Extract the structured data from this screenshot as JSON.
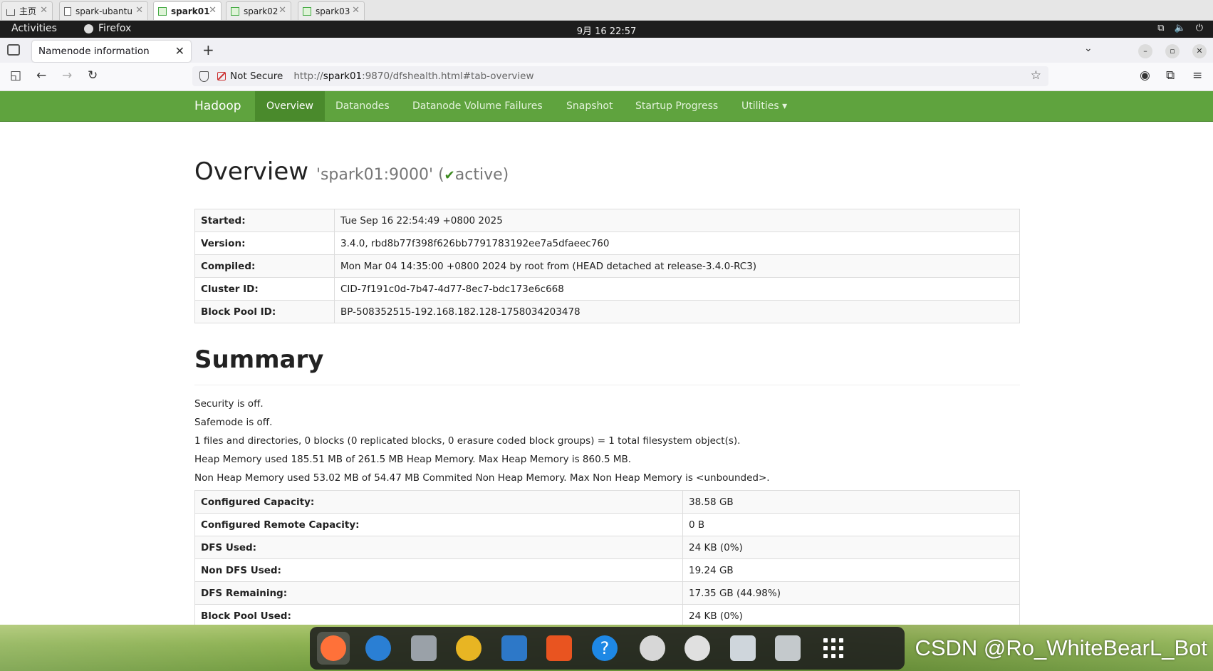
{
  "vm_tabs": [
    {
      "label": "主页",
      "active": false
    },
    {
      "label": "spark-ubantu",
      "active": false
    },
    {
      "label": "spark01",
      "active": true
    },
    {
      "label": "spark02",
      "active": false
    },
    {
      "label": "spark03",
      "active": false
    }
  ],
  "gnome": {
    "activities": "Activities",
    "app": "Firefox",
    "clock": "9月 16  22:57"
  },
  "firefox": {
    "tab_title": "Namenode information",
    "not_secure": "Not Secure",
    "url_prefix": "http://",
    "url_host": "spark01",
    "url_rest": ":9870/dfshealth.html#tab-overview"
  },
  "hadoop_nav": {
    "brand": "Hadoop",
    "items": [
      "Overview",
      "Datanodes",
      "Datanode Volume Failures",
      "Snapshot",
      "Startup Progress",
      "Utilities ▾"
    ]
  },
  "overview": {
    "title": "Overview",
    "node": "'spark01:9000' (",
    "check": "✔",
    "state": "active)",
    "rows": [
      {
        "k": "Started:",
        "v": "Tue Sep 16 22:54:49 +0800 2025"
      },
      {
        "k": "Version:",
        "v": "3.4.0, rbd8b77f398f626bb7791783192ee7a5dfaeec760"
      },
      {
        "k": "Compiled:",
        "v": "Mon Mar 04 14:35:00 +0800 2024 by root from (HEAD detached at release-3.4.0-RC3)"
      },
      {
        "k": "Cluster ID:",
        "v": "CID-7f191c0d-7b47-4d77-8ec7-bdc173e6c668"
      },
      {
        "k": "Block Pool ID:",
        "v": "BP-508352515-192.168.182.128-1758034203478"
      }
    ]
  },
  "summary": {
    "title": "Summary",
    "lines": [
      "Security is off.",
      "Safemode is off.",
      "1 files and directories, 0 blocks (0 replicated blocks, 0 erasure coded block groups) = 1 total filesystem object(s).",
      "Heap Memory used 185.51 MB of 261.5 MB Heap Memory. Max Heap Memory is 860.5 MB.",
      "Non Heap Memory used 53.02 MB of 54.47 MB Commited Non Heap Memory. Max Non Heap Memory is <unbounded>."
    ],
    "rows": [
      {
        "k": "Configured Capacity:",
        "v": "38.58 GB"
      },
      {
        "k": "Configured Remote Capacity:",
        "v": "0 B"
      },
      {
        "k": "DFS Used:",
        "v": "24 KB (0%)"
      },
      {
        "k": "Non DFS Used:",
        "v": "19.24 GB"
      },
      {
        "k": "DFS Remaining:",
        "v": "17.35 GB (44.98%)"
      },
      {
        "k": "Block Pool Used:",
        "v": "24 KB (0%)"
      }
    ]
  },
  "dock": {
    "apps": [
      {
        "name": "firefox-icon",
        "color": "#ff7139",
        "running": true
      },
      {
        "name": "thunderbird-icon",
        "color": "#2a7fd4",
        "running": false
      },
      {
        "name": "files-icon",
        "color": "#9aa1a8",
        "running": false
      },
      {
        "name": "rhythmbox-icon",
        "color": "#e8b523",
        "running": false
      },
      {
        "name": "writer-icon",
        "color": "#2d78c8",
        "running": false
      },
      {
        "name": "app-center-icon",
        "color": "#e95420",
        "running": false
      },
      {
        "name": "help-icon",
        "color": "#1e88e5",
        "running": false
      },
      {
        "name": "disc-icon",
        "color": "#d7d7d7",
        "running": false
      },
      {
        "name": "disc-icon",
        "color": "#e0e0e0",
        "running": false
      },
      {
        "name": "floppy-icon",
        "color": "#cfd6dc",
        "running": false
      },
      {
        "name": "trash-icon",
        "color": "#c4c9cc",
        "running": false
      },
      {
        "name": "app-grid-icon",
        "color": "#ffffff",
        "running": false
      }
    ]
  },
  "watermark": "CSDN @Ro_WhiteBearL_Bot"
}
